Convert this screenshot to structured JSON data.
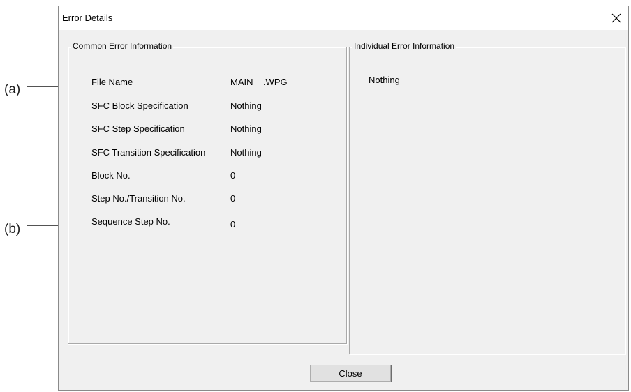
{
  "annotations": {
    "a": "(a)",
    "b": "(b)"
  },
  "dialog": {
    "title": "Error Details",
    "close_glyph": "close-icon"
  },
  "common_group": {
    "legend": "Common Error Information",
    "rows": [
      {
        "label": "File Name",
        "value": "MAIN    .WPG"
      },
      {
        "label": "SFC Block Specification",
        "value": "Nothing"
      },
      {
        "label": "SFC Step Specification",
        "value": "Nothing"
      },
      {
        "label": "SFC Transition Specification",
        "value": "Nothing"
      },
      {
        "label": "Block No.",
        "value": "0"
      },
      {
        "label": "Step No./Transition No.",
        "value": "0"
      },
      {
        "label": "Sequence Step No.",
        "value": "0"
      }
    ]
  },
  "individual_group": {
    "legend": "Individual Error Information",
    "text": "Nothing"
  },
  "buttons": {
    "close_label": "Close"
  }
}
